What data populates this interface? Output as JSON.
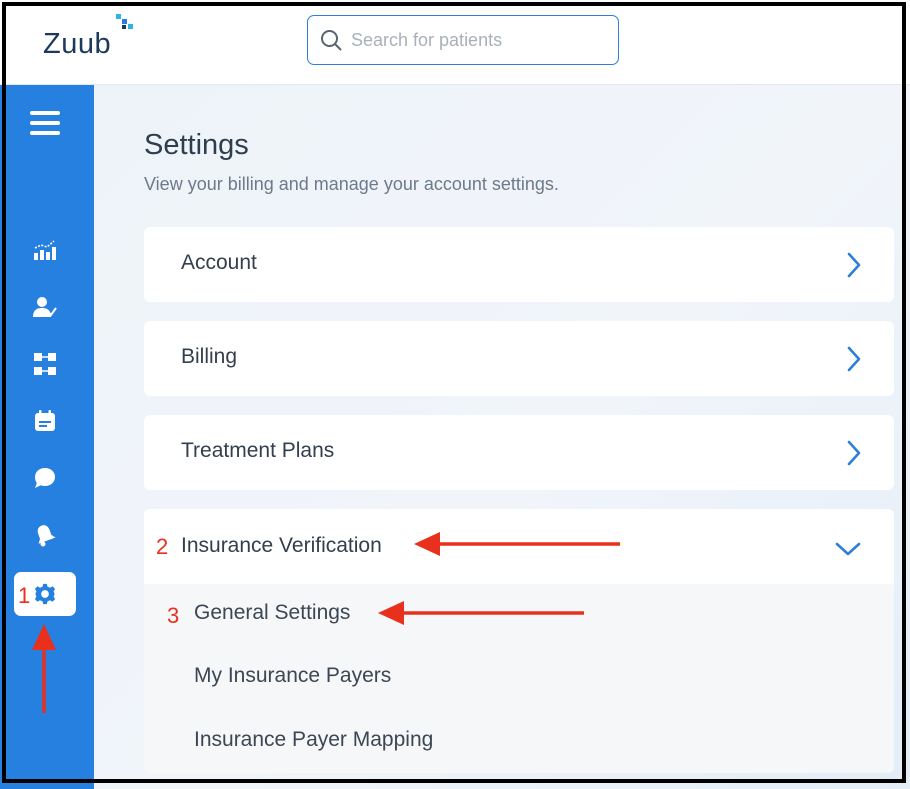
{
  "header": {
    "logo_text": "Zuub",
    "search_placeholder": "Search for patients"
  },
  "sidebar": {
    "items": [
      {
        "icon": "menu-icon"
      },
      {
        "icon": "analytics-icon"
      },
      {
        "icon": "patient-check-icon"
      },
      {
        "icon": "workflow-icon"
      },
      {
        "icon": "calendar-icon"
      },
      {
        "icon": "chat-icon"
      },
      {
        "icon": "notification-bell-icon"
      },
      {
        "icon": "gear-icon",
        "active": true
      }
    ]
  },
  "settings": {
    "title": "Settings",
    "subtitle": "View your billing and manage your account settings.",
    "sections": [
      {
        "label": "Account"
      },
      {
        "label": "Billing"
      },
      {
        "label": "Treatment Plans"
      },
      {
        "label": "Insurance Verification",
        "expanded": true,
        "subitems": [
          "General Settings",
          "My Insurance Payers",
          "Insurance Payer Mapping"
        ]
      }
    ]
  },
  "annotations": {
    "step1": "1",
    "step2": "2",
    "step3": "3",
    "color": "#e8301c"
  },
  "colors": {
    "sidebar": "#2580e0",
    "accent": "#2f7fd8",
    "text": "#333f4c"
  }
}
